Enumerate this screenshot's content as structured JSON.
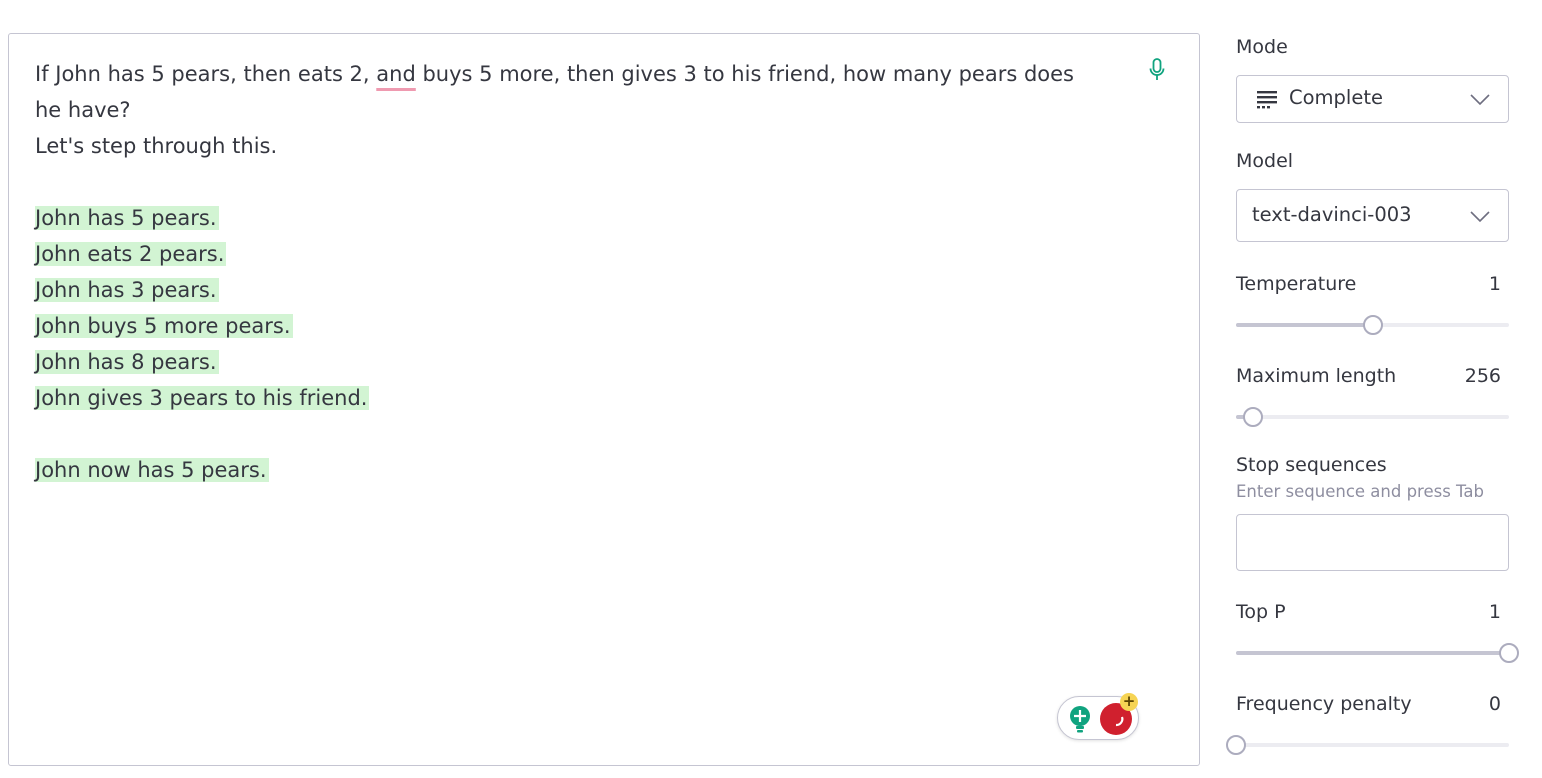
{
  "editor": {
    "prompt_lines": [
      "If John has 5 pears, then eats 2, ",
      "and",
      " buys 5 more, then gives 3 to his friend, how many pears does",
      "he have?",
      "Let's step through this."
    ],
    "generated_lines": [
      "John has 5 pears.",
      "John eats 2 pears.",
      "John has 3 pears.",
      "John buys 5 more pears.",
      "John has 8 pears.",
      "John gives 3 pears to his friend."
    ],
    "final_line": "John now has 5 pears.",
    "highlight_color": "#d2f4d3",
    "spellcheck_color": "#ef9ab0"
  },
  "sidebar": {
    "mode": {
      "label": "Mode",
      "value": "Complete",
      "icon": "complete-mode-icon"
    },
    "model": {
      "label": "Model",
      "value": "text-davinci-003"
    },
    "temperature": {
      "label": "Temperature",
      "value": "1",
      "level": 0.5
    },
    "maximum_length": {
      "label": "Maximum length",
      "value": "256",
      "level": 0.063
    },
    "stop_sequences": {
      "label": "Stop sequences",
      "hint": "Enter sequence and press Tab",
      "input_value": ""
    },
    "top_p": {
      "label": "Top P",
      "value": "1",
      "level": 1.0
    },
    "frequency_penalty": {
      "label": "Frequency penalty",
      "value": "0",
      "level": 0.0
    }
  },
  "icons": {
    "mic": "microphone-icon",
    "extension_bulb": "lightbulb-icon",
    "extension_red": "red-circle-icon",
    "extension_plus": "plus-badge-icon"
  },
  "colors": {
    "accent_green": "#10a37f",
    "slider_fill": "#c5c5d2",
    "slider_track": "#ececf1"
  }
}
